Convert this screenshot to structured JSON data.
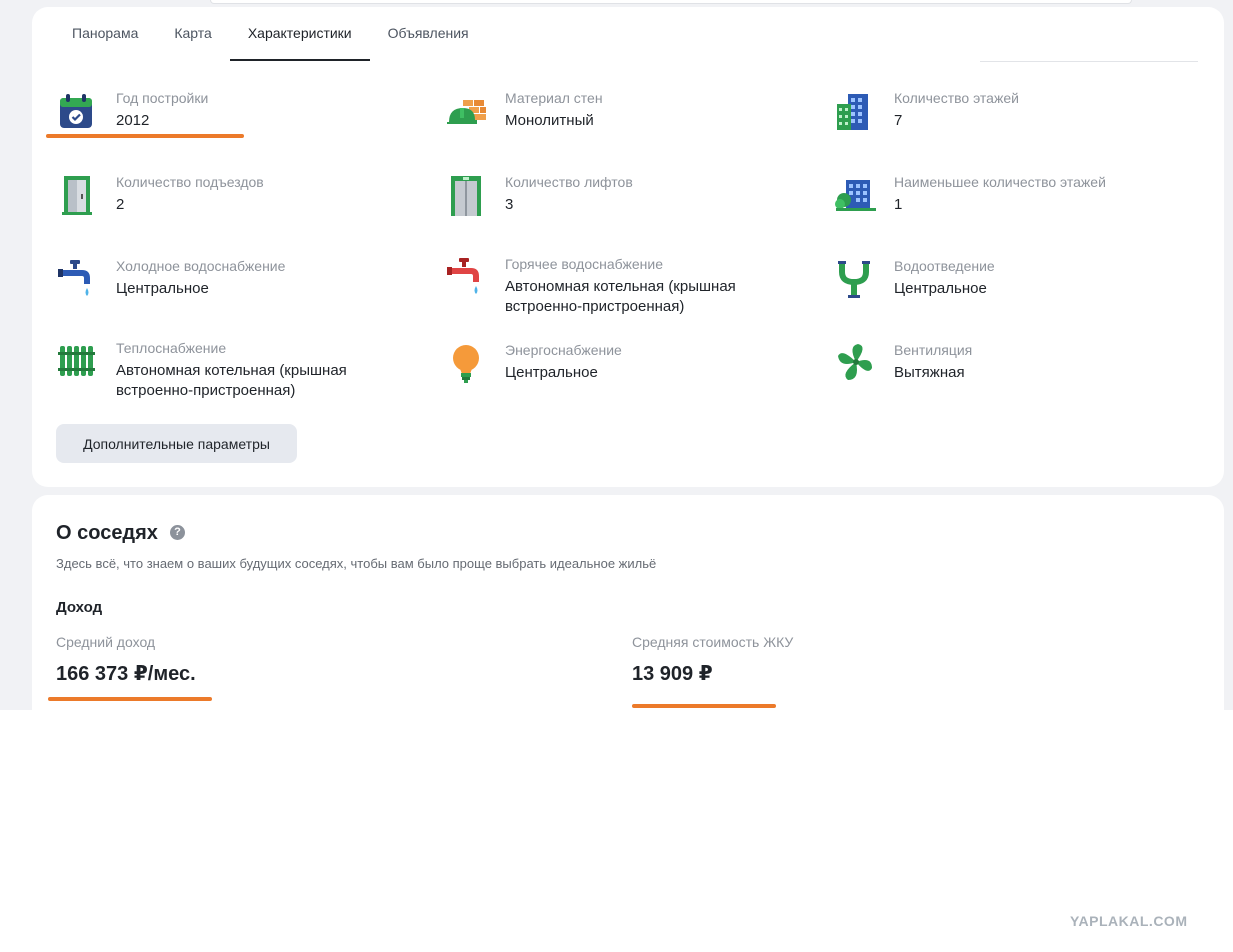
{
  "tabs": [
    "Панорама",
    "Карта",
    "Характеристики",
    "Объявления"
  ],
  "features": [
    {
      "label": "Год постройки",
      "value": "2012",
      "icon": "calendar-check-icon"
    },
    {
      "label": "Материал стен",
      "value": "Монолитный",
      "icon": "brick-helmet-icon"
    },
    {
      "label": "Количество этажей",
      "value": "7",
      "icon": "tall-building-icon"
    },
    {
      "label": "Количество подъездов",
      "value": "2",
      "icon": "entrance-door-icon"
    },
    {
      "label": "Количество лифтов",
      "value": "3",
      "icon": "elevator-icon"
    },
    {
      "label": "Наименьшее количество этажей",
      "value": "1",
      "icon": "low-building-icon"
    },
    {
      "label": "Холодное водоснабжение",
      "value": "Центральное",
      "icon": "cold-water-tap-icon"
    },
    {
      "label": "Горячее водоснабжение",
      "value": "Автономная котельная (крышная встроенно-пристроенная)",
      "icon": "hot-water-tap-icon"
    },
    {
      "label": "Водоотведение",
      "value": "Центральное",
      "icon": "drain-pipe-icon"
    },
    {
      "label": "Теплоснабжение",
      "value": "Автономная котельная (крышная встроенно-пристроенная)",
      "icon": "radiator-icon"
    },
    {
      "label": "Энергоснабжение",
      "value": "Центральное",
      "icon": "light-bulb-icon"
    },
    {
      "label": "Вентиляция",
      "value": "Вытяжная",
      "icon": "fan-icon"
    }
  ],
  "more_button": "Дополнительные параметры",
  "neighbors": {
    "title": "О соседях",
    "help": "?",
    "subtitle": "Здесь всё, что знаем о ваших будущих соседях, чтобы вам было проще выбрать идеальное жильё",
    "income_heading": "Доход",
    "avg_income_label": "Средний доход",
    "avg_income_value": "166 373 ₽/мес.",
    "utilities_label": "Средняя стоимость ЖКУ",
    "utilities_value": "13 909 ₽"
  },
  "watermark": "YAPLAKAL.COM",
  "colors": {
    "highlight": "#ec7a2a",
    "card": "#ffffff",
    "page_bg": "#f1f2f5",
    "button_bg": "#e6e9ef"
  }
}
